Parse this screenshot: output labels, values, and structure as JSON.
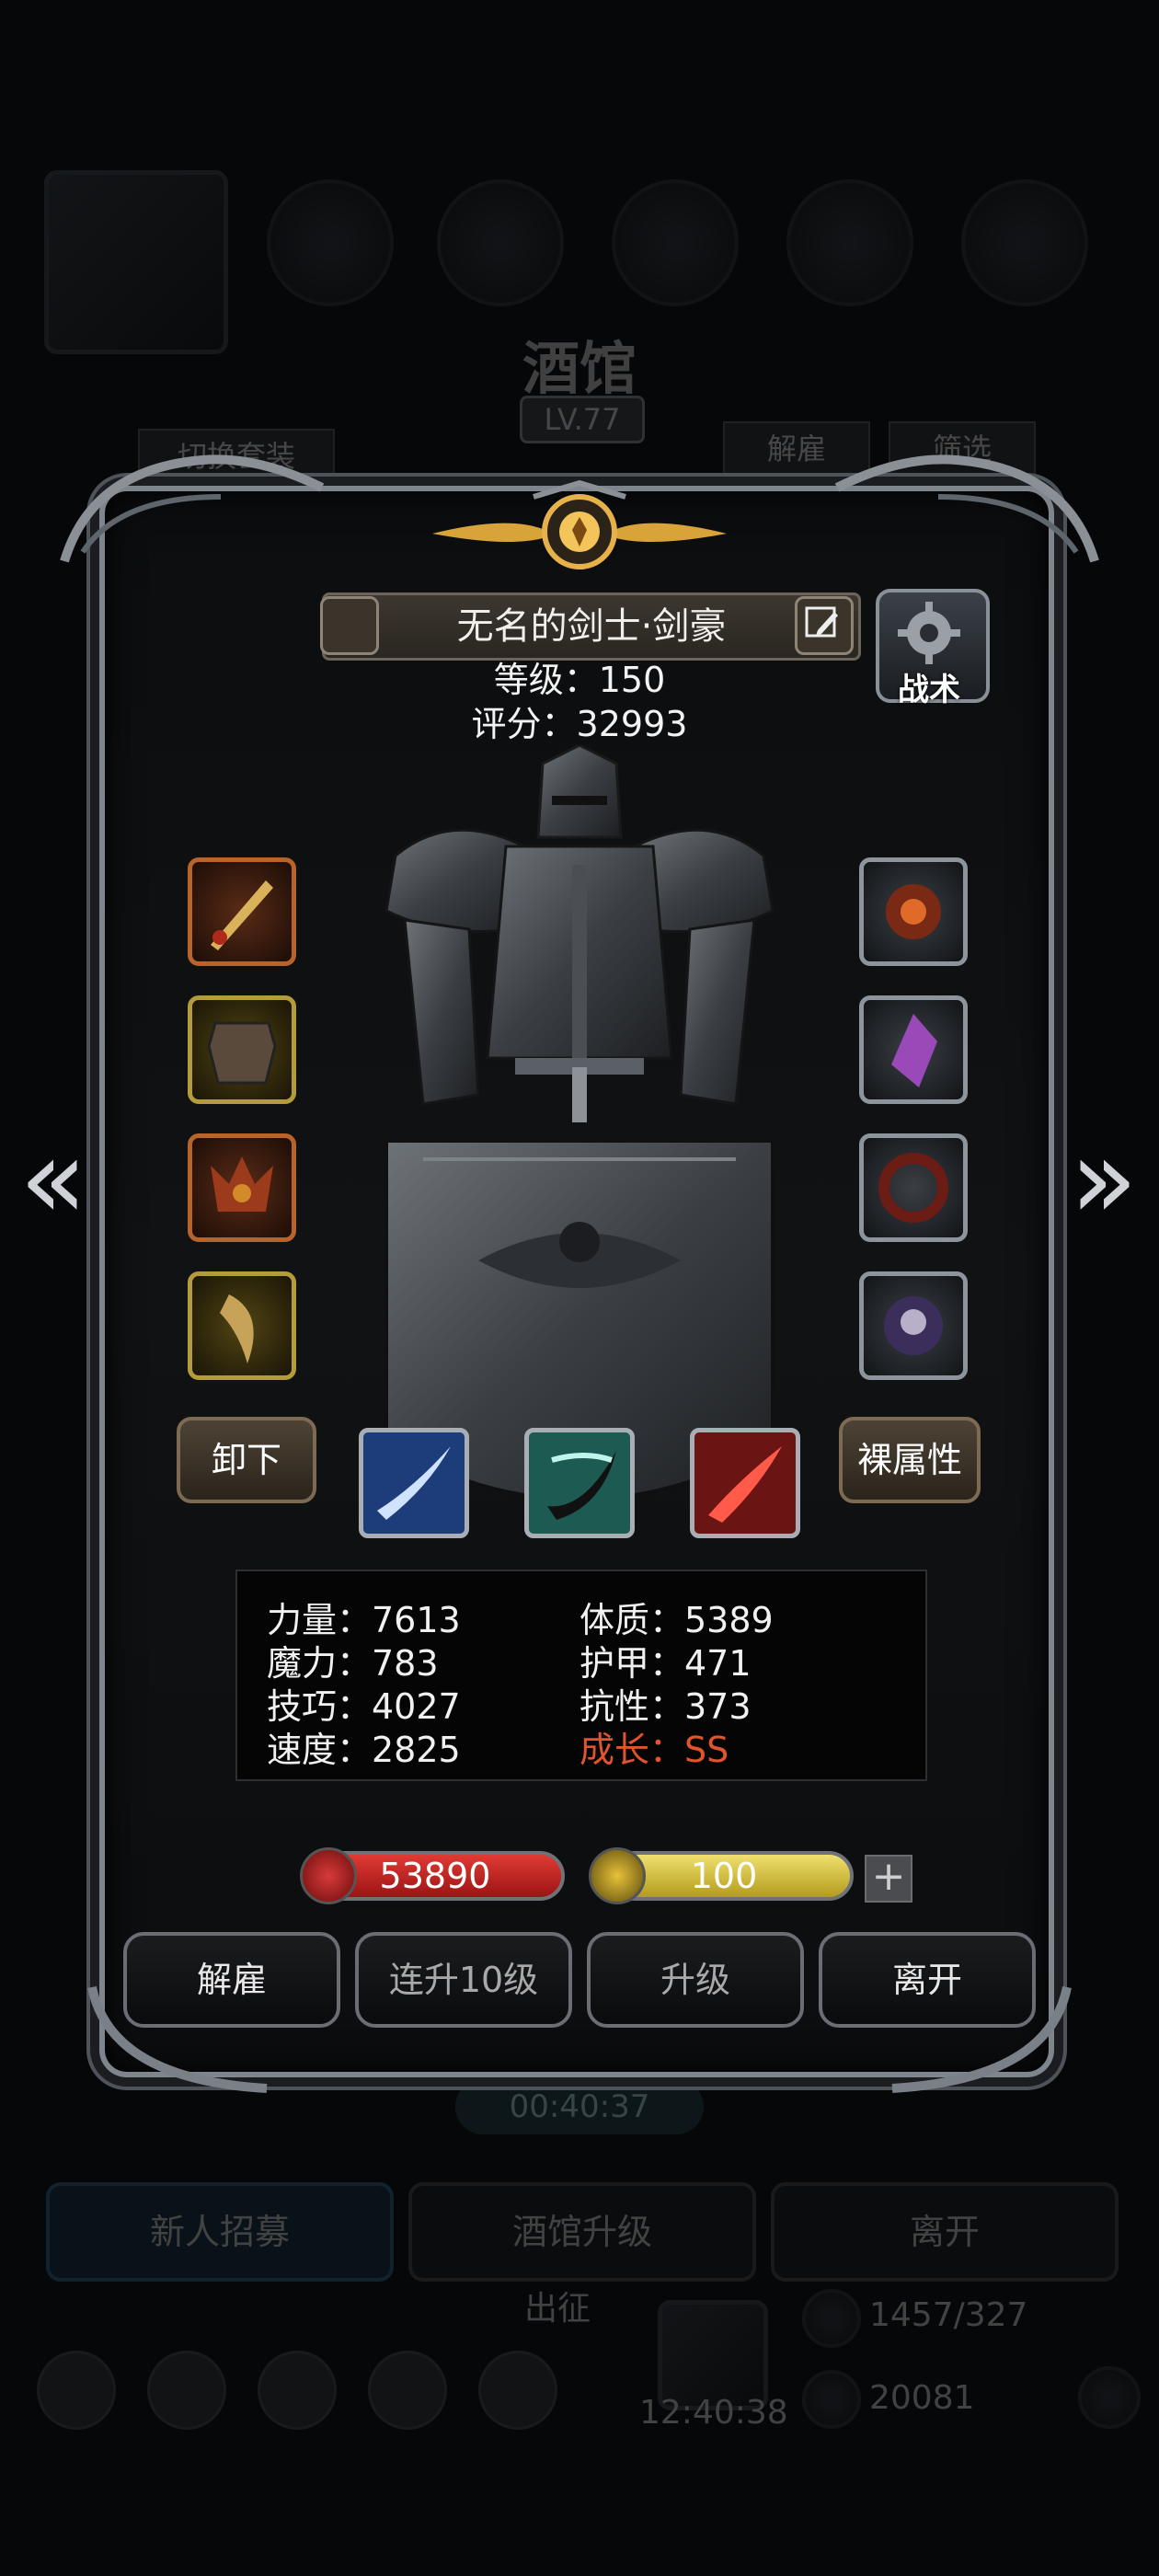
{
  "background": {
    "tavern_title": "酒馆",
    "tavern_level": "LV.77",
    "switch_outfit_label": "切换套装",
    "dismiss_label": "解雇",
    "filter_label": "筛选",
    "timer": "00:40:37",
    "bottom_buttons": [
      "新人招募",
      "酒馆升级",
      "离开"
    ],
    "expedition_label": "出征",
    "clock": "12:40:38",
    "gold": "1457/327",
    "gems": "20081"
  },
  "hero": {
    "name": "无名的剑士·剑豪",
    "level_text": "等级：150",
    "score_text": "评分：32993",
    "tactic_label": "战术"
  },
  "equipment": {
    "left": [
      "sword-icon",
      "armor-icon",
      "demon-mask-icon",
      "claw-icon"
    ],
    "right": [
      "fire-orb-icon",
      "crystal-icon",
      "dark-ring-icon",
      "skull-medal-icon"
    ]
  },
  "controls": {
    "unequip_label": "卸下",
    "base_attr_label": "裸属性"
  },
  "skills": [
    "blue-slash-icon",
    "teal-slash-icon",
    "red-slash-icon"
  ],
  "stats": {
    "strength": "力量：7613",
    "constitution": "体质：5389",
    "magic": "魔力：783",
    "armor": "护甲：471",
    "skill": "技巧：4027",
    "resistance": "抗性：373",
    "speed": "速度：2825",
    "growth": "成长：SS"
  },
  "bars": {
    "hp": "53890",
    "energy": "100",
    "plus": "+"
  },
  "actions": {
    "dismiss": "解雇",
    "level_up_10": "连升10级",
    "level_up": "升级",
    "leave": "离开"
  },
  "colors": {
    "hp": "#c42424",
    "energy": "#c9b82a",
    "growth": "#e2542c"
  }
}
